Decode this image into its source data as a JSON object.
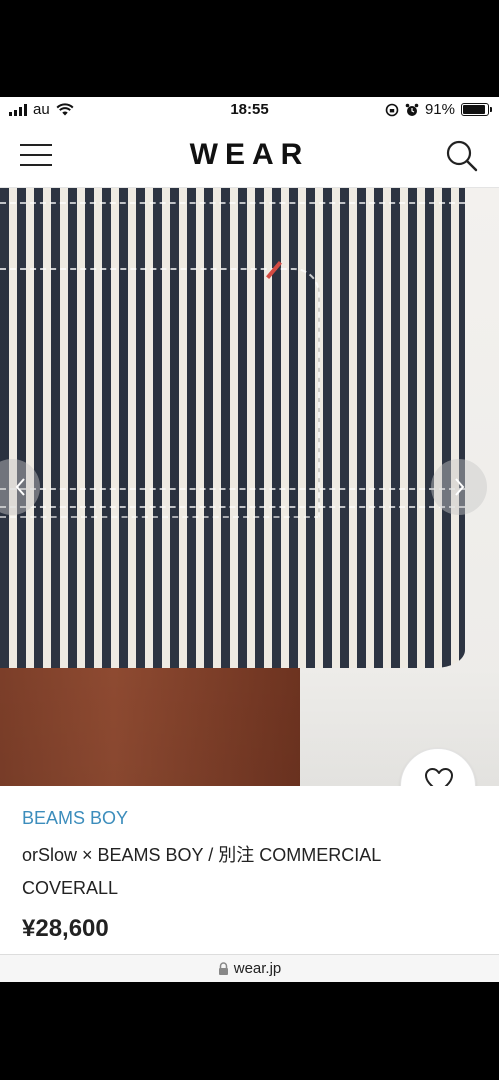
{
  "status_bar": {
    "carrier": "au",
    "time": "18:55",
    "battery": "91%",
    "battery_level": 0.91
  },
  "header": {
    "logo": "WEAR",
    "menu_icon": "hamburger-menu-icon",
    "search_icon": "search-icon"
  },
  "gallery": {
    "prev_icon": "chevron-left-icon",
    "next_icon": "chevron-right-icon"
  },
  "like": {
    "icon": "heart-icon",
    "count": "0"
  },
  "product": {
    "brand": "BEAMS BOY",
    "name": "orSlow × BEAMS BOY / 別注 COMMERCIAL COVERALL",
    "price": "¥28,600"
  },
  "url_bar": {
    "lock_icon": "lock-icon",
    "domain": "wear.jp"
  },
  "colors": {
    "brand_link": "#3c8dbc",
    "text": "#222222",
    "background": "#ffffff"
  }
}
